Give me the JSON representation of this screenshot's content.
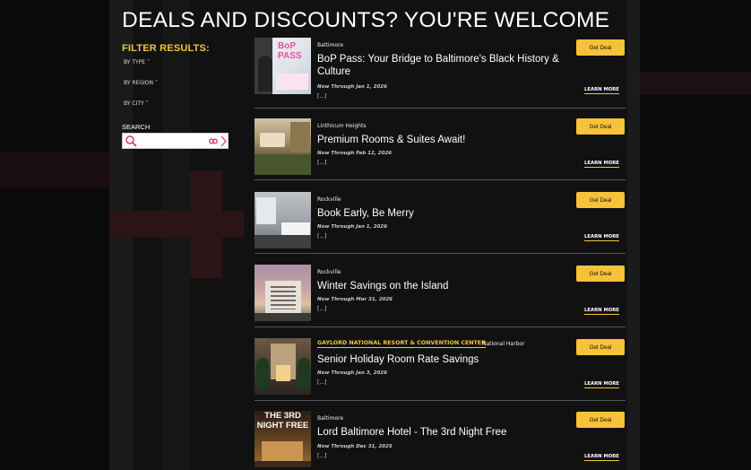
{
  "page": {
    "title": "DEALS AND DISCOUNTS? YOU'RE WELCOME"
  },
  "sidebar": {
    "filter_title": "FILTER RESULTS:",
    "filters": [
      "BY TYPE",
      "BY REGION",
      "BY CITY"
    ],
    "search_label": "SEARCH",
    "search_value": "",
    "search_placeholder": ""
  },
  "deals": [
    {
      "city": "Baltimore",
      "partner": "",
      "name": "BoP Pass: Your Bridge to Baltimore's Black History & Culture",
      "dates": "Now Through Jan 1, 2026",
      "more": "[...]",
      "button": "Get Deal",
      "learn": "LEARN MORE",
      "thumb_text": "BoP PASS"
    },
    {
      "city": "Linthicum Heights",
      "partner": "",
      "name": "Premium Rooms & Suites Await!",
      "dates": "Now Through Feb 12, 2026",
      "more": "[...]",
      "button": "Get Deal",
      "learn": "LEARN MORE",
      "thumb_text": ""
    },
    {
      "city": "Rockville",
      "partner": "",
      "name": "Book Early, Be Merry",
      "dates": "Now Through Jan 1, 2026",
      "more": "[...]",
      "button": "Get Deal",
      "learn": "LEARN MORE",
      "thumb_text": ""
    },
    {
      "city": "Rockville",
      "partner": "",
      "name": "Winter Savings on the Island",
      "dates": "Now Through Mar 31, 2026",
      "more": "[...]",
      "button": "Get Deal",
      "learn": "LEARN MORE",
      "thumb_text": ""
    },
    {
      "city": "National Harbor",
      "partner": "GAYLORD NATIONAL RESORT & CONVENTION CENTER",
      "name": "Senior Holiday Room Rate Savings",
      "dates": "Now Through Jan 3, 2026",
      "more": "[...]",
      "button": "Get Deal",
      "learn": "LEARN MORE",
      "thumb_text": ""
    },
    {
      "city": "Baltimore",
      "partner": "",
      "name": "Lord Baltimore Hotel - The 3rd Night Free",
      "dates": "Now Through Dec 31, 2025",
      "more": "[...]",
      "button": "Get Deal",
      "learn": "LEARN MORE",
      "thumb_text": "THE 3RD NIGHT FREE"
    }
  ],
  "colors": {
    "accent": "#f2c43a",
    "button": "#f5c23a",
    "background": "#111111"
  }
}
